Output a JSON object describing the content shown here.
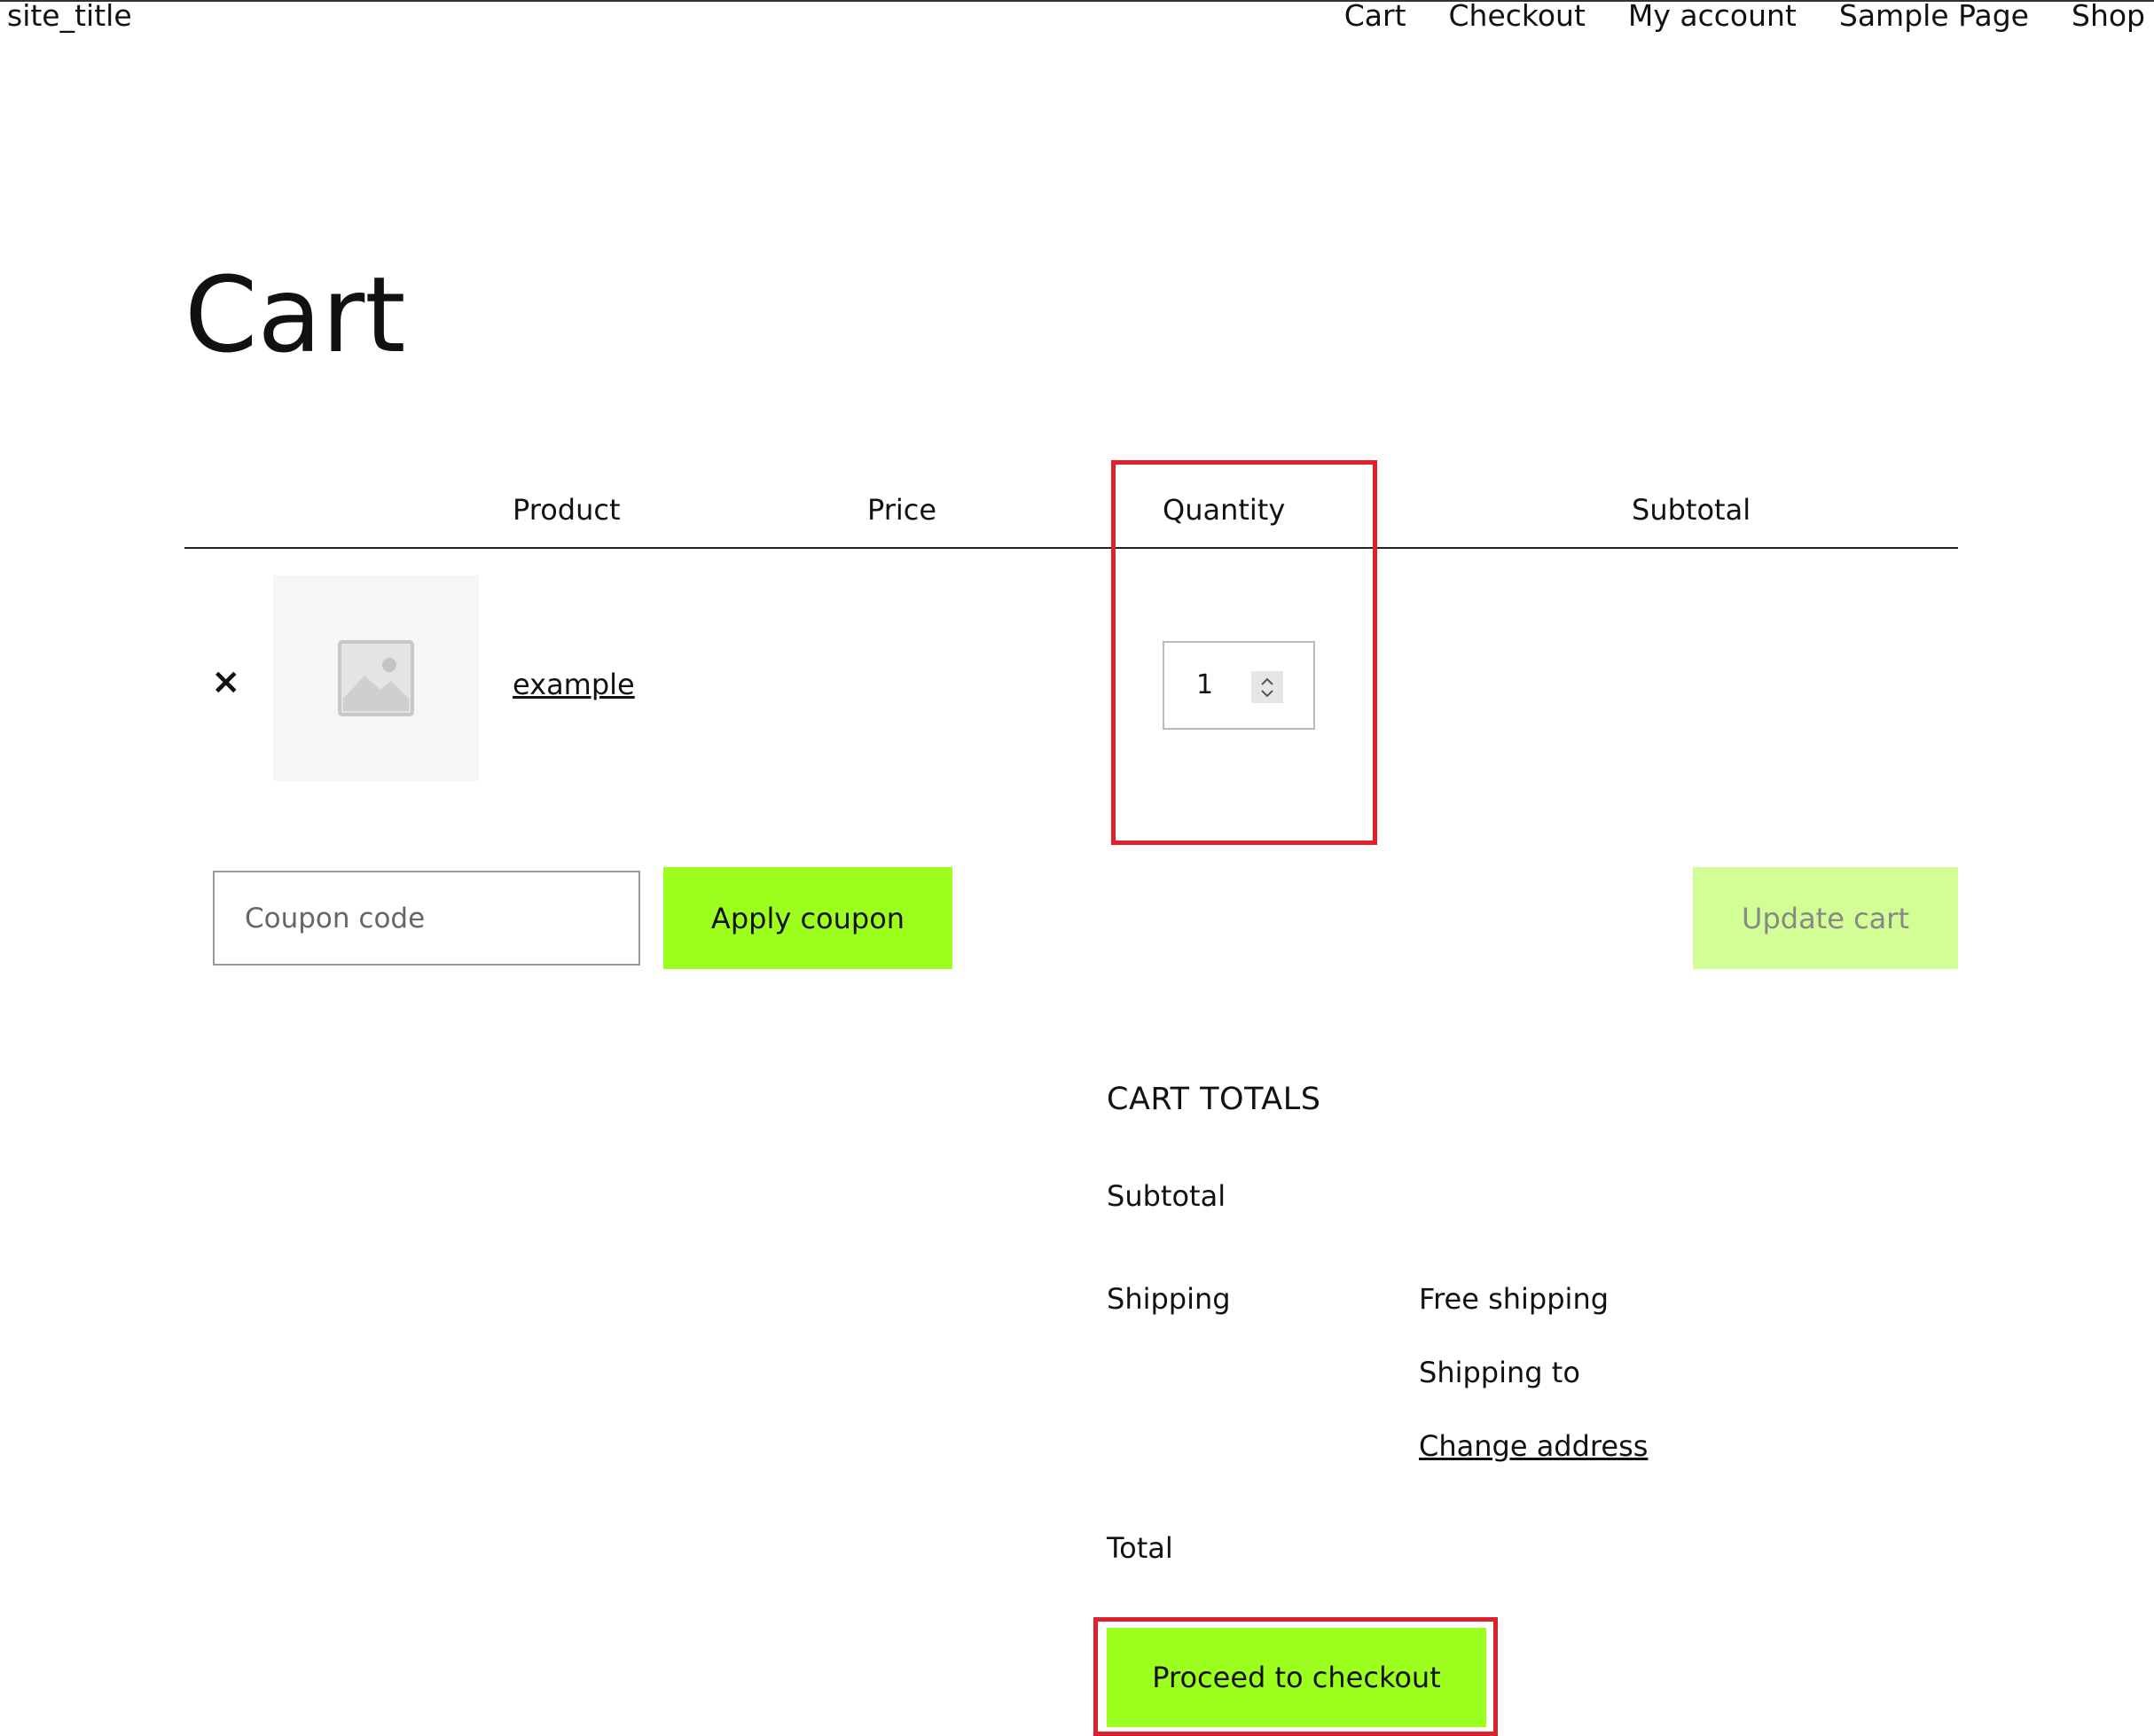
{
  "site": {
    "title": "site_title"
  },
  "nav": {
    "items": [
      "Cart",
      "Checkout",
      "My account",
      "Sample Page",
      "Shop"
    ]
  },
  "page": {
    "title": "Cart"
  },
  "cart_table": {
    "headers": {
      "product": "Product",
      "price": "Price",
      "quantity": "Quantity",
      "subtotal": "Subtotal"
    },
    "rows": [
      {
        "remove_symbol": "×",
        "product_name": "example",
        "price": "",
        "quantity": "1",
        "subtotal": ""
      }
    ]
  },
  "coupon": {
    "placeholder": "Coupon code",
    "value": "",
    "apply_label": "Apply coupon"
  },
  "update_cart_label": "Update cart",
  "cart_totals": {
    "heading": "CART TOTALS",
    "subtotal_label": "Subtotal",
    "subtotal_value": "",
    "shipping_label": "Shipping",
    "shipping_method": "Free shipping",
    "shipping_to": "Shipping to",
    "change_address": "Change address",
    "total_label": "Total",
    "total_value": "",
    "checkout_label": "Proceed to checkout"
  },
  "colors": {
    "accent_button": "#9cff1e",
    "disabled_button": "#d3fe96",
    "highlight": "#e0202a"
  }
}
